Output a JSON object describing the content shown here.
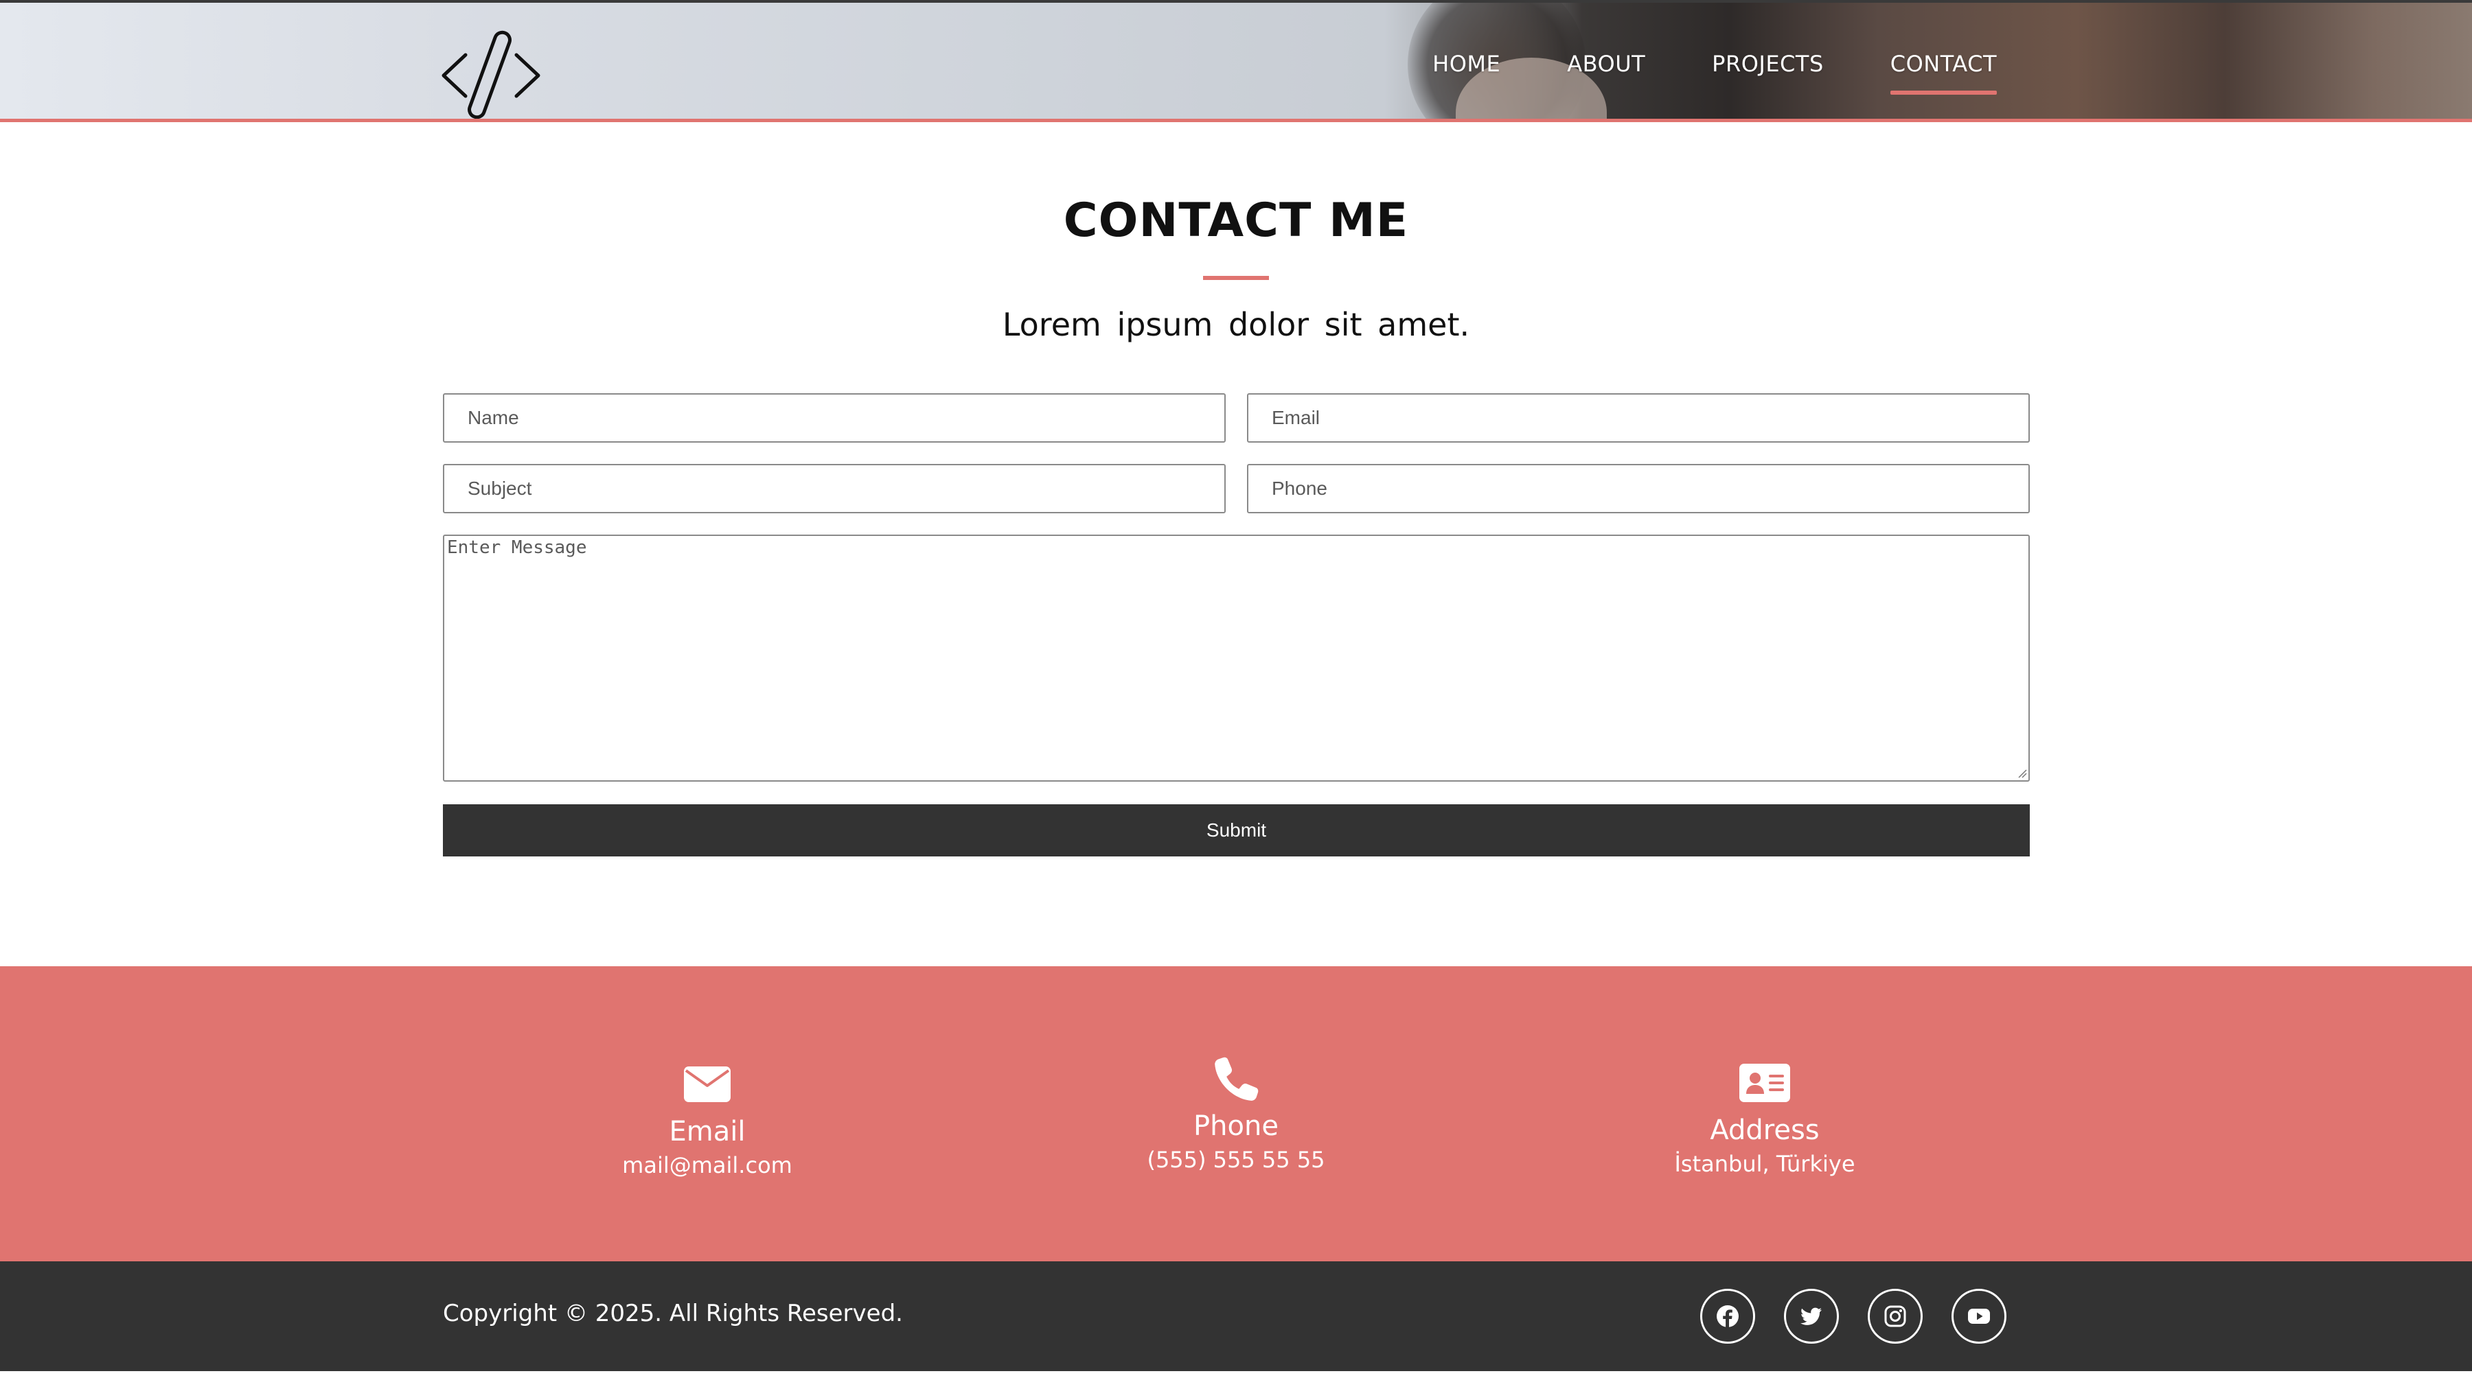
{
  "header": {
    "logo_icon": "code-brackets-icon",
    "nav": [
      {
        "label": "HOME",
        "active": false
      },
      {
        "label": "ABOUT",
        "active": false
      },
      {
        "label": "PROJECTS",
        "active": false
      },
      {
        "label": "CONTACT",
        "active": true
      }
    ]
  },
  "contact": {
    "title": "CONTACT ME",
    "subtitle": "Lorem ipsum dolor sit amet.",
    "form": {
      "name_placeholder": "Name",
      "email_placeholder": "Email",
      "subject_placeholder": "Subject",
      "phone_placeholder": "Phone",
      "message_placeholder": "Enter Message",
      "submit_label": "Submit"
    }
  },
  "info": [
    {
      "icon": "envelope-icon",
      "label": "Email",
      "value": "mail@mail.com"
    },
    {
      "icon": "phone-icon",
      "label": "Phone",
      "value": "(555) 555 55 55"
    },
    {
      "icon": "address-card-icon",
      "label": "Address",
      "value": "İstanbul, Türkiye"
    }
  ],
  "footer": {
    "copyright": "Copyright © 2025. All Rights Reserved.",
    "socials": [
      "facebook-icon",
      "twitter-icon",
      "instagram-icon",
      "youtube-icon"
    ]
  },
  "colors": {
    "accent": "#e07470",
    "dark": "#333333",
    "text": "#111111"
  }
}
